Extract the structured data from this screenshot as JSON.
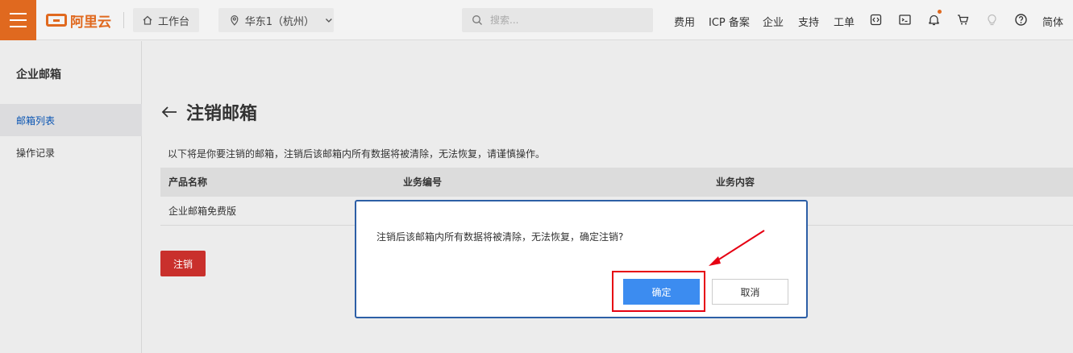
{
  "topbar": {
    "brand": "阿里云",
    "workbench_label": "工作台",
    "region_label": "华东1（杭州）",
    "search_placeholder": "搜索...",
    "nav_links": [
      "费用",
      "ICP 备案",
      "企业",
      "支持",
      "工单"
    ],
    "lang_label": "简体",
    "brand_color": "#e0691f"
  },
  "sidebar": {
    "title": "企业邮箱",
    "items": [
      {
        "label": "邮箱列表",
        "active": true
      },
      {
        "label": "操作记录",
        "active": false
      }
    ]
  },
  "main": {
    "title": "注销邮箱",
    "description": "以下将是你要注销的邮箱，注销后该邮箱内所有数据将被清除，无法恢复，请谨慎操作。",
    "table": {
      "headers": [
        "产品名称",
        "业务编号",
        "业务内容"
      ],
      "rows": [
        [
          "企业邮箱免费版",
          "",
          ""
        ]
      ]
    },
    "cancel_account_button": "注销"
  },
  "modal": {
    "message": "注销后该邮箱内所有数据将被清除，无法恢复，确定注销?",
    "ok_label": "确定",
    "cancel_label": "取消"
  }
}
